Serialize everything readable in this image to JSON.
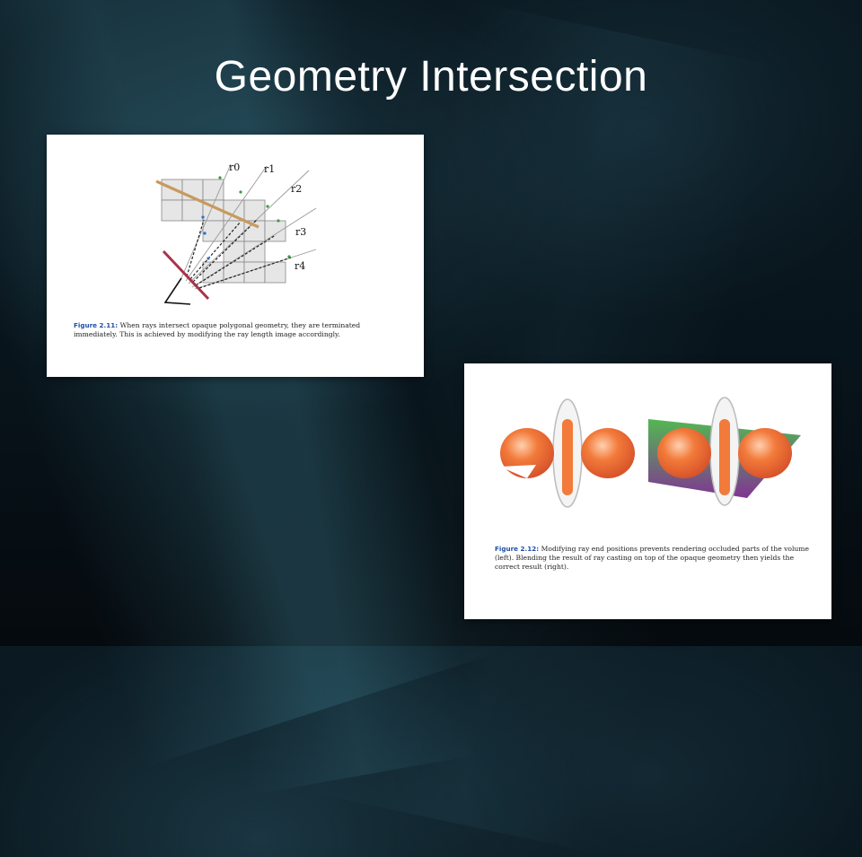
{
  "slide": {
    "title": "Geometry Intersection"
  },
  "figure1": {
    "label": "Figure 2.11:",
    "caption": "When rays intersect opaque polygonal geometry, they are terminated immediately. This is achieved by modifying the ray length image accordingly.",
    "rays": [
      "r0",
      "r1",
      "r2",
      "r3",
      "r4"
    ]
  },
  "figure2": {
    "label": "Figure 2.12:",
    "caption": "Modifying ray end positions prevents rendering occluded parts of the volume (left). Blending the result of ray casting on top of the opaque geometry then yields the correct result (right)."
  },
  "colors": {
    "accent_tan": "#c89a5e",
    "accent_crimson": "#a8334a",
    "volume_orange": "#f27a3a",
    "plane_green": "#49b44a",
    "plane_purple": "#7a2a8c",
    "caption_blue": "#1f4fa8"
  }
}
